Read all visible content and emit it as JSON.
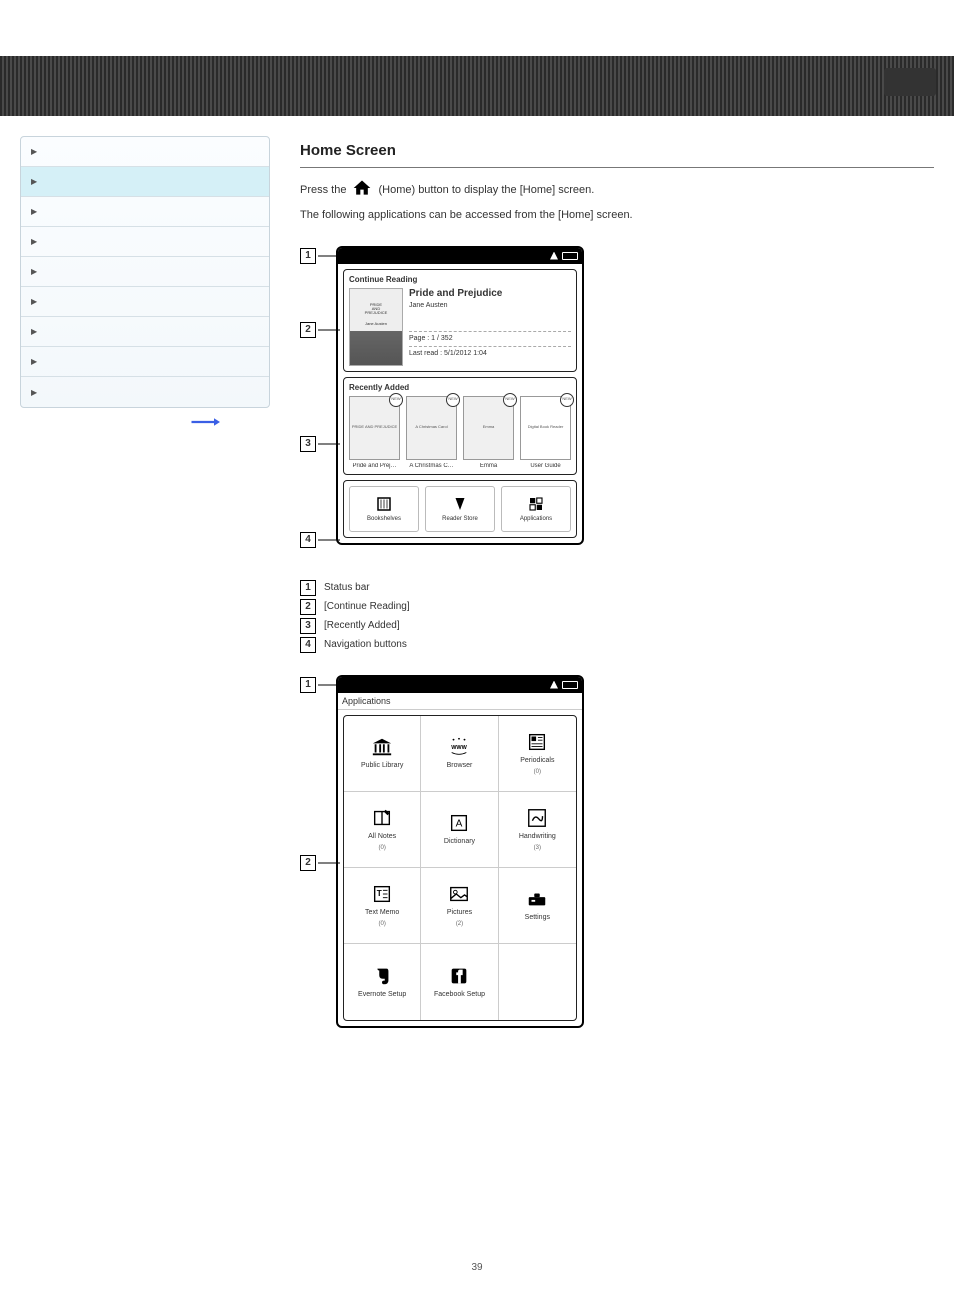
{
  "sidebar": {
    "items": [
      {
        "label": ""
      },
      {
        "label": ""
      },
      {
        "label": ""
      },
      {
        "label": ""
      },
      {
        "label": ""
      },
      {
        "label": ""
      },
      {
        "label": ""
      },
      {
        "label": ""
      },
      {
        "label": ""
      }
    ],
    "active_index": 1
  },
  "section": {
    "title": "Home Screen",
    "intro_prefix": "Press the ",
    "intro_suffix": " (Home) button to display the [Home] screen.",
    "below_text": "The following applications can be accessed from the [Home] screen."
  },
  "callouts_home": [
    "1",
    "2",
    "3",
    "4"
  ],
  "callouts_apps": [
    "1",
    "2"
  ],
  "home_screen": {
    "continue_section": "Continue Reading",
    "book": {
      "cover_line1": "PRIDE",
      "cover_line2": "AND",
      "cover_line3": "PREJUDICE",
      "cover_author": "Jane Austen",
      "title": "Pride and Prejudice",
      "author": "Jane Austen",
      "page_label": "Page : 1 / 352",
      "last_read": "Last read : 5/1/2012 1:04"
    },
    "recent_section": "Recently Added",
    "recent": [
      {
        "thumb": "PRIDE\nAND\nPREJUDICE",
        "caption": "Pride and Prej…",
        "new": "NEW"
      },
      {
        "thumb": "A\nChristmas\nCarol",
        "caption": "A Christmas C…",
        "new": "NEW"
      },
      {
        "thumb": "Emma",
        "caption": "Emma",
        "new": "NEW"
      },
      {
        "thumb": "Digital Book Reader",
        "caption": "User Guide",
        "new": "NEW"
      }
    ],
    "nav": [
      {
        "label": "Bookshelves"
      },
      {
        "label": "Reader Store"
      },
      {
        "label": "Applications"
      }
    ]
  },
  "annot_home": [
    {
      "num": "1",
      "text": "Status bar"
    },
    {
      "num": "2",
      "text": "[Continue Reading]"
    },
    {
      "num": "3",
      "text": "[Recently Added]"
    },
    {
      "num": "4",
      "text": "Navigation buttons"
    }
  ],
  "apps_screen": {
    "header": "Applications",
    "items": [
      {
        "label": "Public Library",
        "count": ""
      },
      {
        "label": "Browser",
        "count": ""
      },
      {
        "label": "Periodicals",
        "count": "(0)"
      },
      {
        "label": "All Notes",
        "count": "(0)"
      },
      {
        "label": "Dictionary",
        "count": ""
      },
      {
        "label": "Handwriting",
        "count": "(3)"
      },
      {
        "label": "Text Memo",
        "count": "(0)"
      },
      {
        "label": "Pictures",
        "count": "(2)"
      },
      {
        "label": "Settings",
        "count": ""
      },
      {
        "label": "Evernote Setup",
        "count": ""
      },
      {
        "label": "Facebook Setup",
        "count": ""
      }
    ]
  },
  "page_number": "39"
}
